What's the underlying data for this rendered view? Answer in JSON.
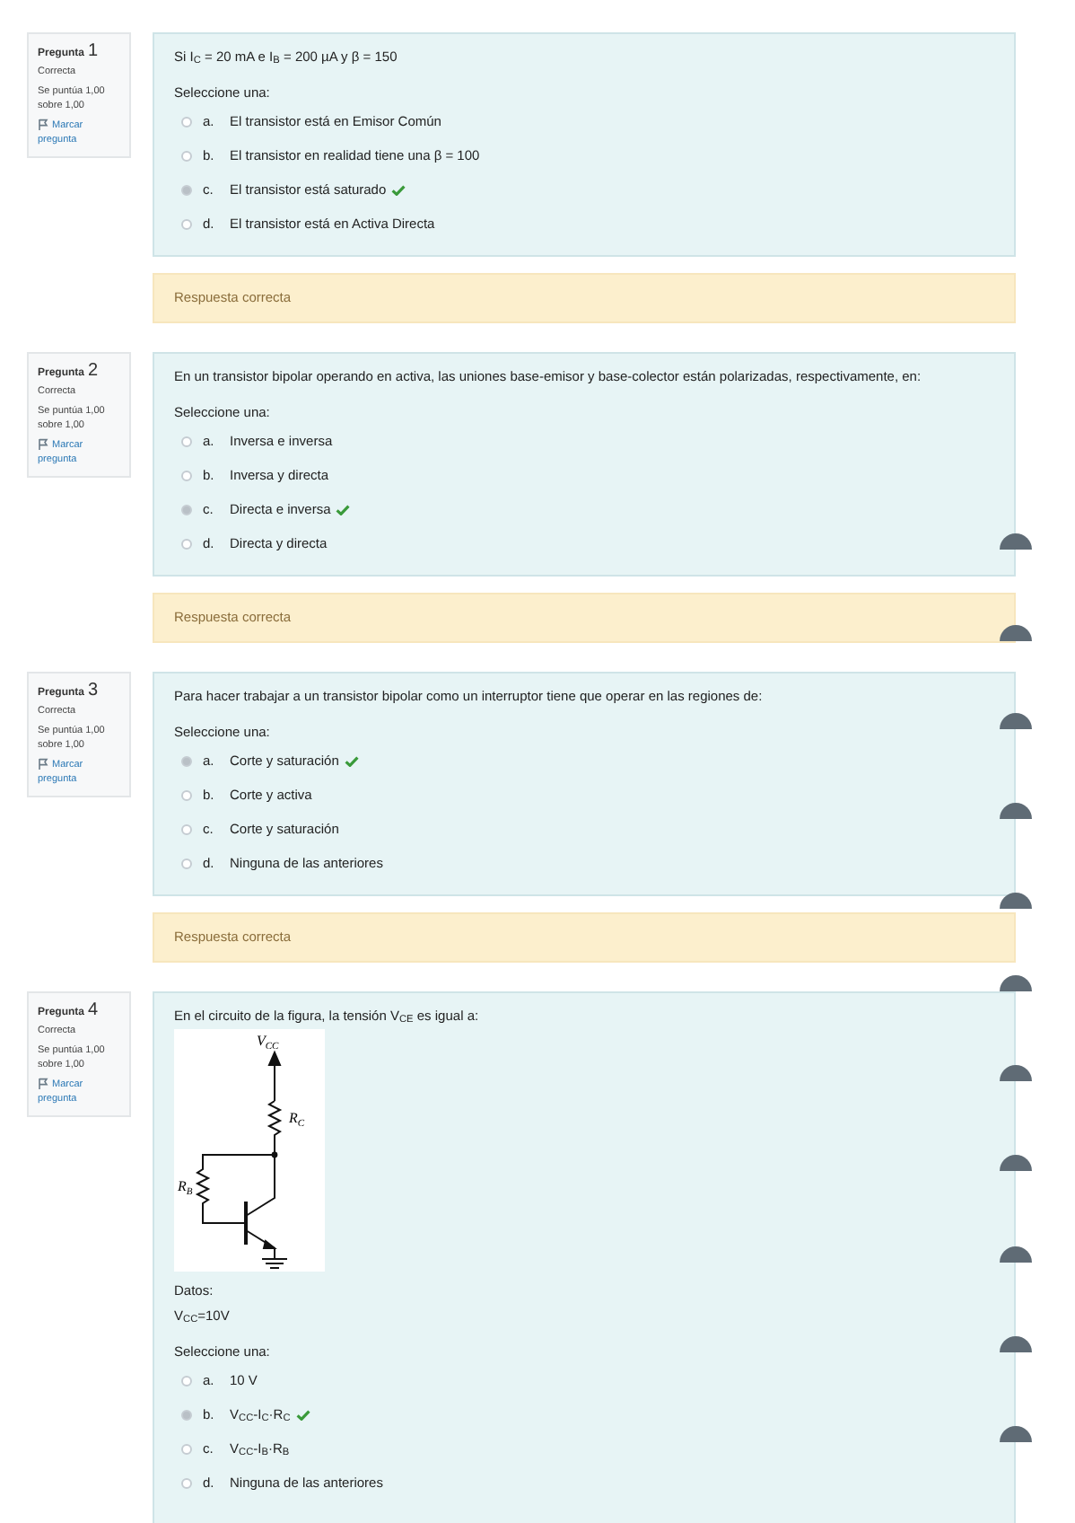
{
  "questions": [
    {
      "number": "1",
      "label": "Pregunta",
      "status": "Correcta",
      "score": "Se puntúa 1,00 sobre 1,00",
      "flag": "Marcar pregunta",
      "text": "Si I$_{C}$ = 20 mA e I$_{B}$ = 200 µA y β = 150",
      "prompt": "Seleccione una:",
      "options": [
        {
          "letter": "a.",
          "text": "El transistor está en Emisor Común",
          "selected": false,
          "correct": false
        },
        {
          "letter": "b.",
          "text": "El transistor en realidad tiene una β = 100",
          "selected": false,
          "correct": false
        },
        {
          "letter": "c.",
          "text": "El transistor está saturado",
          "selected": true,
          "correct": true
        },
        {
          "letter": "d.",
          "text": "El transistor está en Activa Directa",
          "selected": false,
          "correct": false
        }
      ],
      "feedback": "Respuesta correcta"
    },
    {
      "number": "2",
      "label": "Pregunta",
      "status": "Correcta",
      "score": "Se puntúa 1,00 sobre 1,00",
      "flag": "Marcar pregunta",
      "text": "En un transistor bipolar operando en activa, las uniones base-emisor y base-colector están polarizadas, respectivamente, en:",
      "prompt": "Seleccione una:",
      "options": [
        {
          "letter": "a.",
          "text": "Inversa e inversa",
          "selected": false,
          "correct": false
        },
        {
          "letter": "b.",
          "text": "Inversa y directa",
          "selected": false,
          "correct": false
        },
        {
          "letter": "c.",
          "text": "Directa e inversa",
          "selected": true,
          "correct": true
        },
        {
          "letter": "d.",
          "text": "Directa y directa",
          "selected": false,
          "correct": false
        }
      ],
      "feedback": "Respuesta correcta"
    },
    {
      "number": "3",
      "label": "Pregunta",
      "status": "Correcta",
      "score": "Se puntúa 1,00 sobre 1,00",
      "flag": "Marcar pregunta",
      "text": "Para hacer trabajar a un transistor bipolar como un interruptor tiene que operar en las regiones de:",
      "prompt": "Seleccione una:",
      "options": [
        {
          "letter": "a.",
          "text": "Corte y saturación",
          "selected": true,
          "correct": true
        },
        {
          "letter": "b.",
          "text": "Corte y activa",
          "selected": false,
          "correct": false
        },
        {
          "letter": "c.",
          "text": "Corte y saturación",
          "selected": false,
          "correct": false
        },
        {
          "letter": "d.",
          "text": "Ninguna de las anteriores",
          "selected": false,
          "correct": false
        }
      ],
      "feedback": "Respuesta correcta"
    },
    {
      "number": "4",
      "label": "Pregunta",
      "status": "Correcta",
      "score": "Se puntúa 1,00 sobre 1,00",
      "flag": "Marcar pregunta",
      "text": "En el circuito de la figura, la tensión V$_{CE}$ es igual a:",
      "figure": {
        "labels": [
          {
            "main": "V",
            "sub": "CC"
          },
          {
            "main": "R",
            "sub": "C"
          },
          {
            "main": "R",
            "sub": "B"
          }
        ]
      },
      "data_title": "Datos:",
      "data_lines": [
        "V$_{CC}$=10V"
      ],
      "prompt": "Seleccione una:",
      "options": [
        {
          "letter": "a.",
          "text": "10 V",
          "selected": false,
          "correct": false
        },
        {
          "letter": "b.",
          "text": "V$_{CC}$-I$_{C}$·R$_{C}$",
          "selected": true,
          "correct": true
        },
        {
          "letter": "c.",
          "text": "V$_{CC}$-I$_{B}$·R$_{B}$",
          "selected": false,
          "correct": false
        },
        {
          "letter": "d.",
          "text": "Ninguna de las anteriores",
          "selected": false,
          "correct": false
        }
      ]
    }
  ]
}
